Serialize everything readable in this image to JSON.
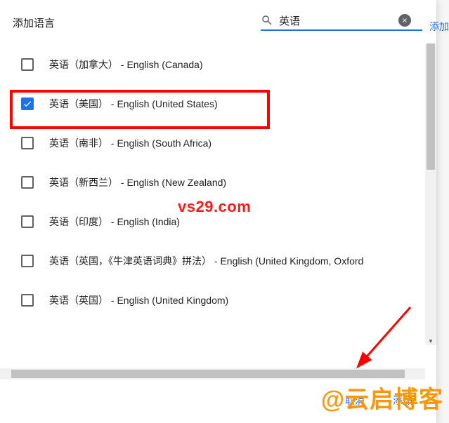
{
  "header": {
    "title": "添加语言",
    "search_value": "英语"
  },
  "items": [
    {
      "label": "英语（加拿大） - English (Canada)",
      "checked": false
    },
    {
      "label": "英语（美国） - English (United States)",
      "checked": true
    },
    {
      "label": "英语（南非） - English (South Africa)",
      "checked": false
    },
    {
      "label": "英语（新西兰） - English (New Zealand)",
      "checked": false
    },
    {
      "label": "英语（印度） - English (India)",
      "checked": false
    },
    {
      "label": "英语（英国，《牛津英语词典》拼法） - English (United Kingdom, Oxford",
      "checked": false
    },
    {
      "label": "英语（英国） - English (United Kingdom)",
      "checked": false
    }
  ],
  "footer": {
    "cancel": "取消",
    "add": "添加"
  },
  "watermarks": {
    "w1": "vs29.com",
    "w2": "@云启博客"
  },
  "side": "添加"
}
